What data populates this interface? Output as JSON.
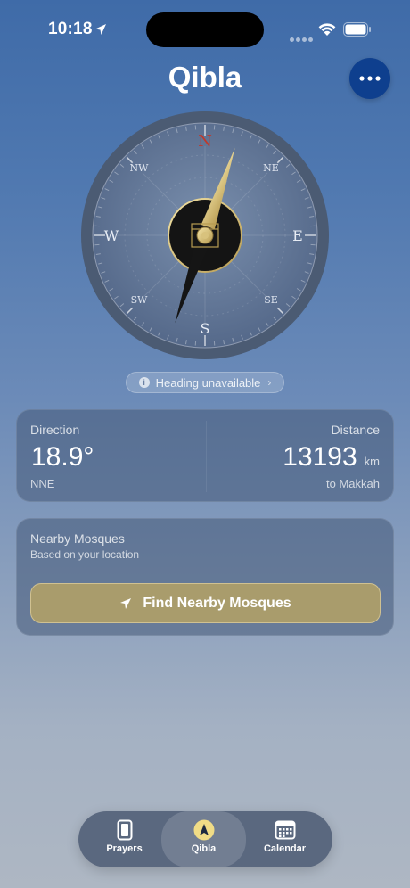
{
  "status_bar": {
    "time": "10:18"
  },
  "header": {
    "title": "Qibla"
  },
  "compass": {
    "cardinals": {
      "n": "N",
      "e": "E",
      "s": "S",
      "w": "W",
      "ne": "NE",
      "se": "SE",
      "sw": "SW",
      "nw": "NW"
    },
    "qibla_bearing_deg": 18.9
  },
  "heading_status": {
    "text": "Heading unavailable"
  },
  "direction_card": {
    "direction_label": "Direction",
    "direction_value": "18.9°",
    "direction_compass": "NNE",
    "distance_label": "Distance",
    "distance_value": "13193",
    "distance_unit": "km",
    "distance_target": "to Makkah"
  },
  "mosques_card": {
    "title": "Nearby Mosques",
    "subtitle": "Based on your location",
    "button_label": "Find Nearby Mosques"
  },
  "tabbar": {
    "tabs": [
      {
        "label": "Prayers",
        "icon": "phone-icon"
      },
      {
        "label": "Qibla",
        "icon": "compass-arrow-icon",
        "active": true
      },
      {
        "label": "Calendar",
        "icon": "calendar-icon"
      }
    ]
  },
  "colors": {
    "accent_gold": "#c9b06a",
    "north_red": "#c0392b",
    "more_button": "#0e3f8e"
  }
}
